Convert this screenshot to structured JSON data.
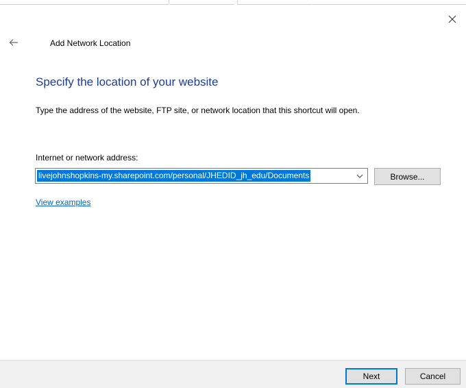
{
  "window": {
    "title": "Add Network Location"
  },
  "page": {
    "heading": "Specify the location of your website",
    "description": "Type the address of the website, FTP site, or network location that this shortcut will open.",
    "address_label": "Internet or network address:",
    "address_value": "livejohnshopkins-my.sharepoint.com/personal/JHEDID_jh_edu/Documents",
    "browse_label": "Browse...",
    "examples_link": "View examples"
  },
  "footer": {
    "next_label": "Next",
    "cancel_label": "Cancel"
  },
  "colors": {
    "heading": "#1e3b96",
    "selection": "#0078d7",
    "link": "#0066cc"
  },
  "icons": {
    "back": "arrow-left-icon",
    "close": "close-icon",
    "dropdown": "chevron-down-icon"
  }
}
